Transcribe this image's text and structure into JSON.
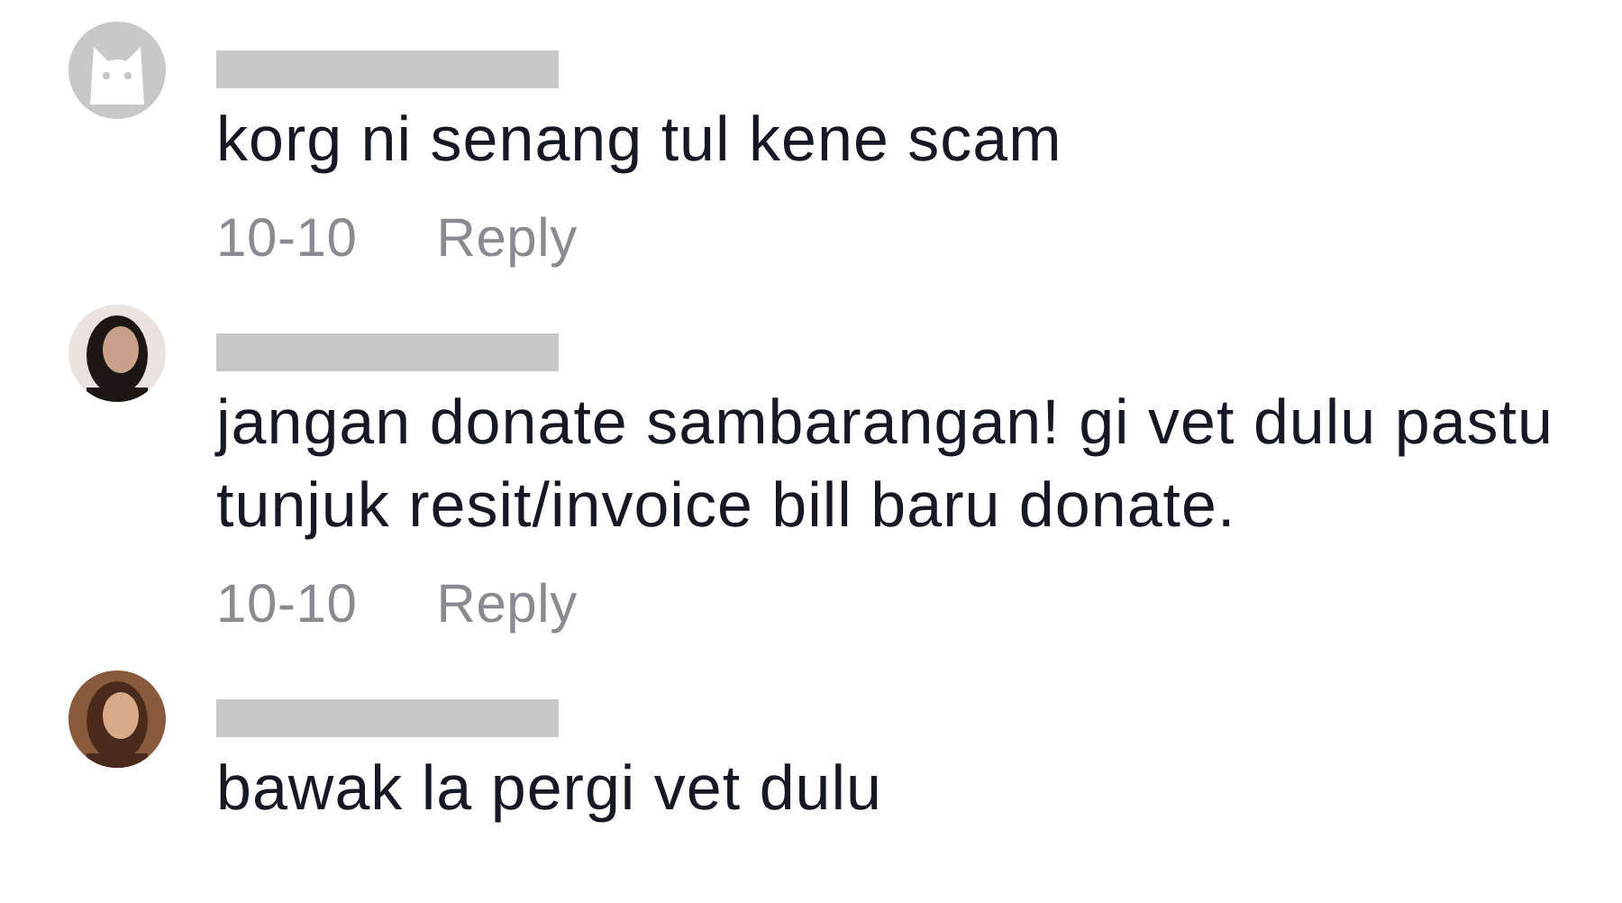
{
  "comments": [
    {
      "avatar": {
        "kind": "default"
      },
      "name_redacted": true,
      "text": "korg ni senang tul kene scam",
      "date": "10-10",
      "reply": "Reply"
    },
    {
      "name_redacted": true,
      "text": "jangan donate sambarangan! gi vet dulu pastu tunjuk resit/invoice bill baru donate.",
      "date": "10-10",
      "reply": "Reply"
    },
    {
      "name_redacted": true,
      "text": "bawak la pergi vet dulu"
    }
  ]
}
